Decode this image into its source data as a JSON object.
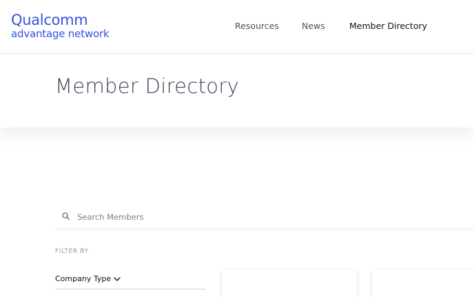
{
  "header": {
    "logo": {
      "line1": "Qualcomm",
      "line2": "advantage network"
    },
    "nav": [
      {
        "label": "Resources"
      },
      {
        "label": "News"
      },
      {
        "label": "Member Directory"
      }
    ],
    "active_nav": "Member Directory"
  },
  "hero": {
    "title": "Member Directory"
  },
  "search": {
    "placeholder": "Search Members",
    "value": "",
    "icon": "search-icon"
  },
  "filters": {
    "label": "FILTER BY",
    "company_type": {
      "label": "Company Type",
      "icon": "chevron-down-icon"
    }
  },
  "colors": {
    "brand": "#3253dc",
    "nav_text": "#4a5160",
    "title_text": "#3a4458"
  }
}
